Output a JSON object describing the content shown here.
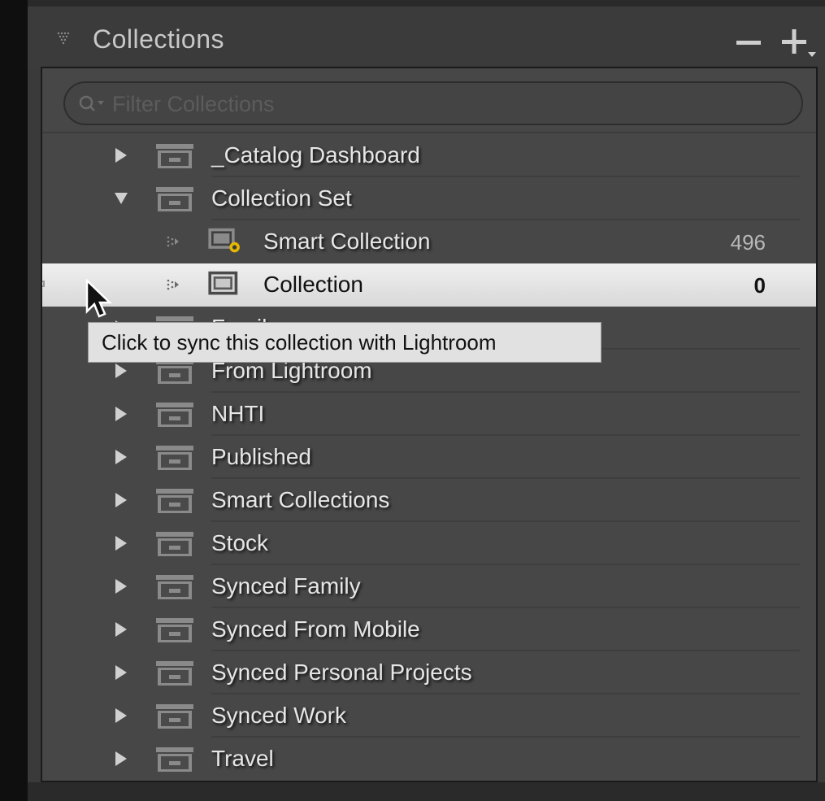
{
  "header": {
    "title": "Collections"
  },
  "filter": {
    "placeholder": "Filter Collections"
  },
  "rows": [
    {
      "label": "_Catalog Dashboard"
    },
    {
      "label": "Collection Set"
    },
    {
      "label": "Smart Collection",
      "count": "496"
    },
    {
      "label": "Collection",
      "count": "0"
    },
    {
      "label": "Family"
    },
    {
      "label": "From Lightroom"
    },
    {
      "label": "NHTI"
    },
    {
      "label": "Published"
    },
    {
      "label": "Smart Collections"
    },
    {
      "label": "Stock"
    },
    {
      "label": "Synced Family"
    },
    {
      "label": "Synced From Mobile"
    },
    {
      "label": "Synced Personal Projects"
    },
    {
      "label": "Synced Work"
    },
    {
      "label": "Travel"
    }
  ],
  "tooltip": {
    "text": "Click to sync this collection with Lightroom"
  },
  "colors": {
    "panel": "#3a3a3a",
    "list": "#474747",
    "selected": "#e4e4e4",
    "text": "#e6e6e6"
  }
}
